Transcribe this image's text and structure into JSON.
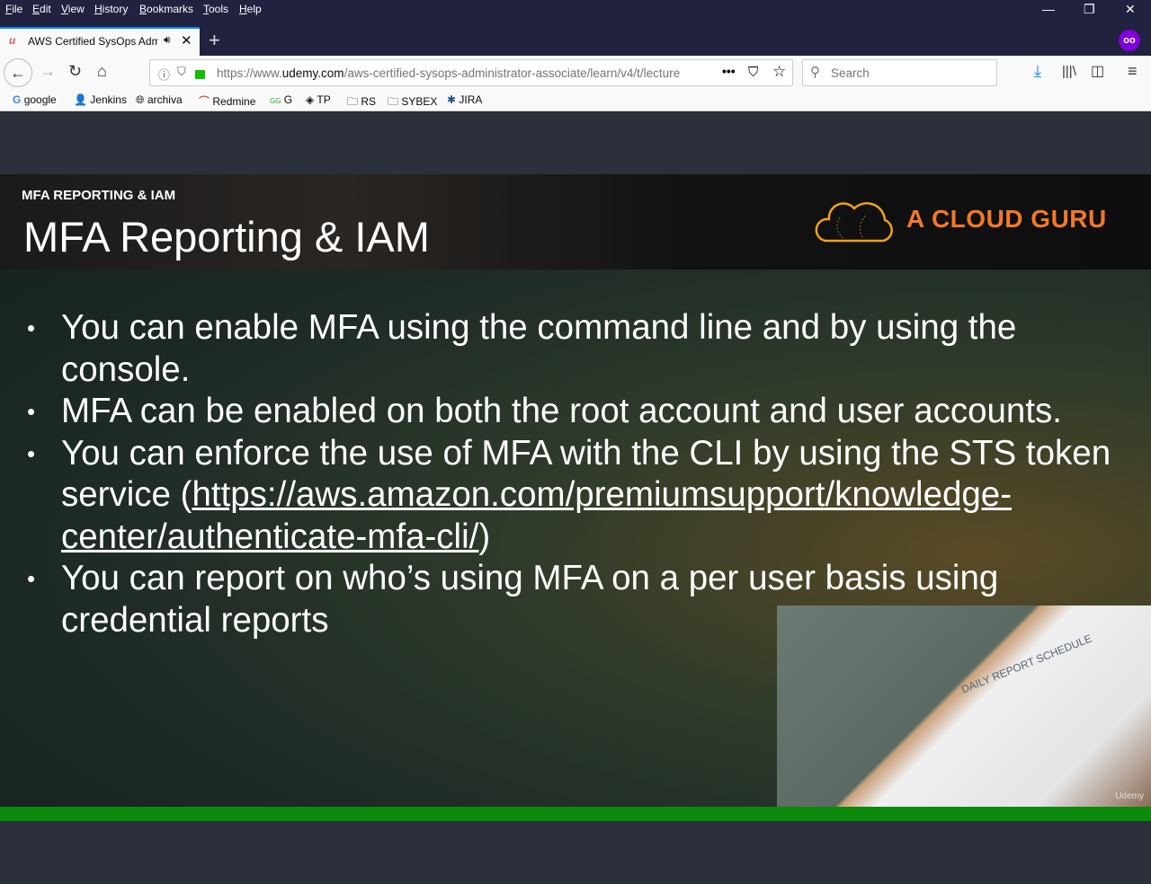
{
  "menu": [
    "File",
    "Edit",
    "View",
    "History",
    "Bookmarks",
    "Tools",
    "Help"
  ],
  "tab": {
    "title": "AWS Certified SysOps Administrator - Associate",
    "favicon": "udemy-icon"
  },
  "url": {
    "prefix": "https://www.",
    "domain": "udemy.com",
    "path": "/aws-certified-sysops-administrator-associate/learn/v4/t/lecture"
  },
  "search_placeholder": "Search",
  "bookmarks": [
    "google",
    "Jenkins",
    "archiva",
    "Redmine",
    "G",
    "TP",
    "RS",
    "SYBEX",
    "JIRA"
  ],
  "slide": {
    "subtitle": "MFA REPORTING & IAM",
    "title": "MFA Reporting & IAM",
    "logo": "A CLOUD GURU",
    "bullets": [
      "You can enable MFA using the command line and by using the console.",
      "MFA can be enabled on both the root account and user accounts."
    ],
    "bullet3_pre": "You can enforce the use of MFA with the CLI by using the STS token service (",
    "bullet3_link": "https://aws.amazon.com/premiumsupport/knowledge-center/authenticate-mfa-cli/",
    "bullet3_post": ")",
    "bullet4": "You can report on who’s using MFA on a per user basis using credential reports",
    "photo_caption": "DAILY REPORT SCHEDULE",
    "watermark": "Udemy"
  },
  "colors": {
    "chrome": "#20223f",
    "accent": "#0a84ff",
    "logo": "#f2782a",
    "progress": "#0b8a0b"
  }
}
